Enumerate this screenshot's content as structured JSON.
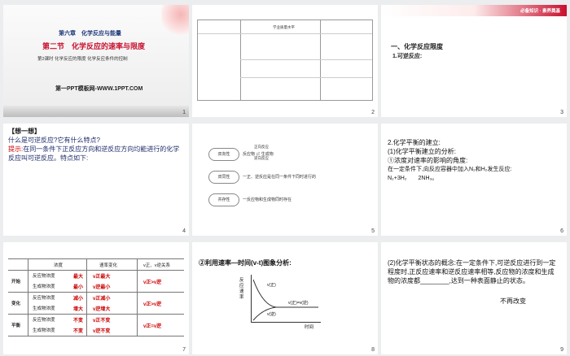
{
  "slides": [
    {
      "num": "1",
      "chapter": "第六章　化学反应与能量",
      "section": "第二节　化学反应的速率与限度",
      "lesson": "第2课时 化学反应的限度 化学反应条件的控制",
      "brand": "第一PPT模板网-WWW.1PPT.COM"
    },
    {
      "num": "2",
      "header": "学业质量水平"
    },
    {
      "num": "3",
      "banner": "必备知识 · 素养奠基",
      "heading": "一、化学反应限度",
      "sub": "1.可逆反应:"
    },
    {
      "num": "4",
      "title": "【想一想】",
      "q": "什么是可逆反应?它有什么特点?",
      "hint_label": "提示:",
      "hint": "在同一条件下正反应方向和逆反应方向均能进行的化学反应叫可逆反应。特点如下:"
    },
    {
      "num": "5",
      "pills": [
        "双向性",
        "双同性",
        "共存性"
      ],
      "items": [
        "反应物 ⇌ 生成物",
        "一正、逆反应是在同一条件下同时进行的",
        "一反应物和生成物同时存在"
      ],
      "arrow_top": "正向反应",
      "arrow_bot": "逆向反应"
    },
    {
      "num": "6",
      "l1": "2.化学平衡的建立:",
      "l2": "(1)化学平衡建立的分析:",
      "l3": "①浓度对速率的影响的角度:",
      "l4": "在一定条件下,向反应容器中加入N₂和H₂发生反应:",
      "l5": "N₂+3H₂　　2NH₃。"
    },
    {
      "num": "7",
      "headers": [
        "浓度",
        "速率变化",
        "v正、v逆关系"
      ],
      "rows": [
        "开始",
        "变化",
        "平衡"
      ],
      "sub": [
        "反应物浓度",
        "生成物浓度"
      ],
      "answers": [
        "最大",
        "最小",
        "减小",
        "增大",
        "不变",
        "不变"
      ],
      "rates": [
        "v正最大",
        "v逆最小",
        "v正减小",
        "v逆增大",
        "v正不变",
        "v逆不变"
      ],
      "rel": [
        "v正>v逆",
        "v正>v逆",
        "v正=v逆"
      ]
    },
    {
      "num": "8",
      "title": "②利用速率—时间(v-t)图象分析:",
      "ylabel": "反应速率",
      "xlabel": "时间",
      "curves": [
        "v(正)",
        "v(逆)",
        "v(正)=v(逆)"
      ]
    },
    {
      "num": "9",
      "text": "(2)化学平衡状态的概念:在一定条件下,可逆反应进行到一定程度时,正反应速率和逆反应速率相等,反应物的浓度和生成物的浓度都",
      "blank": "________",
      "tail": ",达到一种表面静止的状态。",
      "answer": "不再改变"
    }
  ]
}
